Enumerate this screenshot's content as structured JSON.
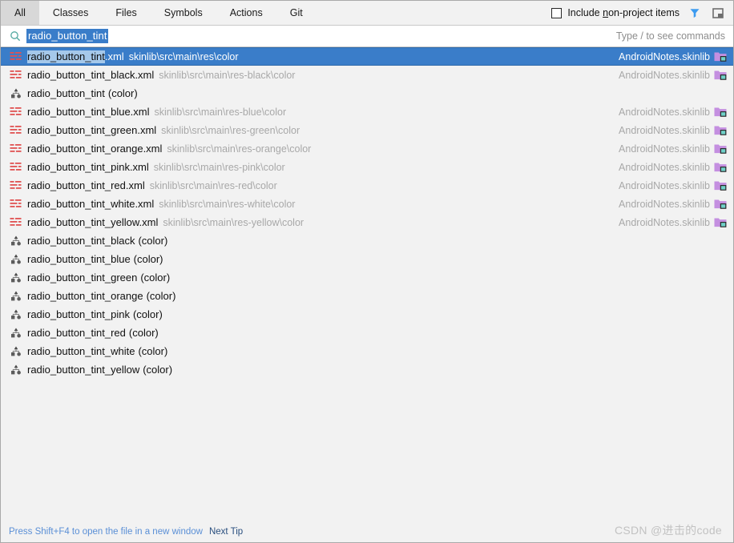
{
  "tabs": [
    {
      "label": "All",
      "selected": true
    },
    {
      "label": "Classes",
      "selected": false
    },
    {
      "label": "Files",
      "selected": false
    },
    {
      "label": "Symbols",
      "selected": false
    },
    {
      "label": "Actions",
      "selected": false
    },
    {
      "label": "Git",
      "selected": false
    }
  ],
  "header": {
    "include_non_project_prefix": "Include ",
    "include_non_project_mnemonic": "n",
    "include_non_project_suffix": "on-project items",
    "filter_icon": "filter-funnel-icon",
    "window_icon": "open-in-window-icon",
    "checkbox_checked": false
  },
  "search": {
    "icon": "search-icon",
    "value": "radio_button_tint",
    "selected": true,
    "hint": "Type / to see commands"
  },
  "results": [
    {
      "icon": "xml-file-icon",
      "match": "radio_button_tint",
      "rest": ".xml",
      "path": "skinlib\\src\\main\\res\\color",
      "module": "AndroidNotes.skinlib",
      "module_icon": "module-folder-icon",
      "selected": true
    },
    {
      "icon": "xml-file-icon",
      "match": "radio_button_tint",
      "rest": "_black.xml",
      "path": "skinlib\\src\\main\\res-black\\color",
      "module": "AndroidNotes.skinlib",
      "module_icon": "module-folder-icon",
      "selected": false
    },
    {
      "icon": "color-symbol-icon",
      "match": "radio_button_tint",
      "rest": "",
      "suffix": "(color)",
      "path": "",
      "module": "",
      "module_icon": "",
      "selected": false
    },
    {
      "icon": "xml-file-icon",
      "match": "radio_button_tint",
      "rest": "_blue.xml",
      "path": "skinlib\\src\\main\\res-blue\\color",
      "module": "AndroidNotes.skinlib",
      "module_icon": "module-folder-icon",
      "selected": false
    },
    {
      "icon": "xml-file-icon",
      "match": "radio_button_tint",
      "rest": "_green.xml",
      "path": "skinlib\\src\\main\\res-green\\color",
      "module": "AndroidNotes.skinlib",
      "module_icon": "module-folder-icon",
      "selected": false
    },
    {
      "icon": "xml-file-icon",
      "match": "radio_button_tint",
      "rest": "_orange.xml",
      "path": "skinlib\\src\\main\\res-orange\\color",
      "module": "AndroidNotes.skinlib",
      "module_icon": "module-folder-icon",
      "selected": false
    },
    {
      "icon": "xml-file-icon",
      "match": "radio_button_tint",
      "rest": "_pink.xml",
      "path": "skinlib\\src\\main\\res-pink\\color",
      "module": "AndroidNotes.skinlib",
      "module_icon": "module-folder-icon",
      "selected": false
    },
    {
      "icon": "xml-file-icon",
      "match": "radio_button_tint",
      "rest": "_red.xml",
      "path": "skinlib\\src\\main\\res-red\\color",
      "module": "AndroidNotes.skinlib",
      "module_icon": "module-folder-icon",
      "selected": false
    },
    {
      "icon": "xml-file-icon",
      "match": "radio_button_tint",
      "rest": "_white.xml",
      "path": "skinlib\\src\\main\\res-white\\color",
      "module": "AndroidNotes.skinlib",
      "module_icon": "module-folder-icon",
      "selected": false
    },
    {
      "icon": "xml-file-icon",
      "match": "radio_button_tint",
      "rest": "_yellow.xml",
      "path": "skinlib\\src\\main\\res-yellow\\color",
      "module": "AndroidNotes.skinlib",
      "module_icon": "module-folder-icon",
      "selected": false
    },
    {
      "icon": "color-symbol-icon",
      "match": "radio_button_tint",
      "rest": "_black",
      "suffix": "(color)",
      "path": "",
      "module": "",
      "module_icon": "",
      "selected": false
    },
    {
      "icon": "color-symbol-icon",
      "match": "radio_button_tint",
      "rest": "_blue",
      "suffix": "(color)",
      "path": "",
      "module": "",
      "module_icon": "",
      "selected": false
    },
    {
      "icon": "color-symbol-icon",
      "match": "radio_button_tint",
      "rest": "_green",
      "suffix": "(color)",
      "path": "",
      "module": "",
      "module_icon": "",
      "selected": false
    },
    {
      "icon": "color-symbol-icon",
      "match": "radio_button_tint",
      "rest": "_orange",
      "suffix": "(color)",
      "path": "",
      "module": "",
      "module_icon": "",
      "selected": false
    },
    {
      "icon": "color-symbol-icon",
      "match": "radio_button_tint",
      "rest": "_pink",
      "suffix": "(color)",
      "path": "",
      "module": "",
      "module_icon": "",
      "selected": false
    },
    {
      "icon": "color-symbol-icon",
      "match": "radio_button_tint",
      "rest": "_red",
      "suffix": "(color)",
      "path": "",
      "module": "",
      "module_icon": "",
      "selected": false
    },
    {
      "icon": "color-symbol-icon",
      "match": "radio_button_tint",
      "rest": "_white",
      "suffix": "(color)",
      "path": "",
      "module": "",
      "module_icon": "",
      "selected": false
    },
    {
      "icon": "color-symbol-icon",
      "match": "radio_button_tint",
      "rest": "_yellow",
      "suffix": "(color)",
      "path": "",
      "module": "",
      "module_icon": "",
      "selected": false
    }
  ],
  "footer": {
    "tip": "Press Shift+F4 to open the file in a new window",
    "next_tip": "Next Tip"
  },
  "watermark": "CSDN @进击的code",
  "colors": {
    "selection_blue": "#3a7dc9",
    "xml_icon_red": "#e05252",
    "module_purple": "#c48fe0",
    "filter_blue": "#3d9bf0",
    "search_icon_teal": "#52a8a0",
    "background": "#f2f2f2"
  }
}
